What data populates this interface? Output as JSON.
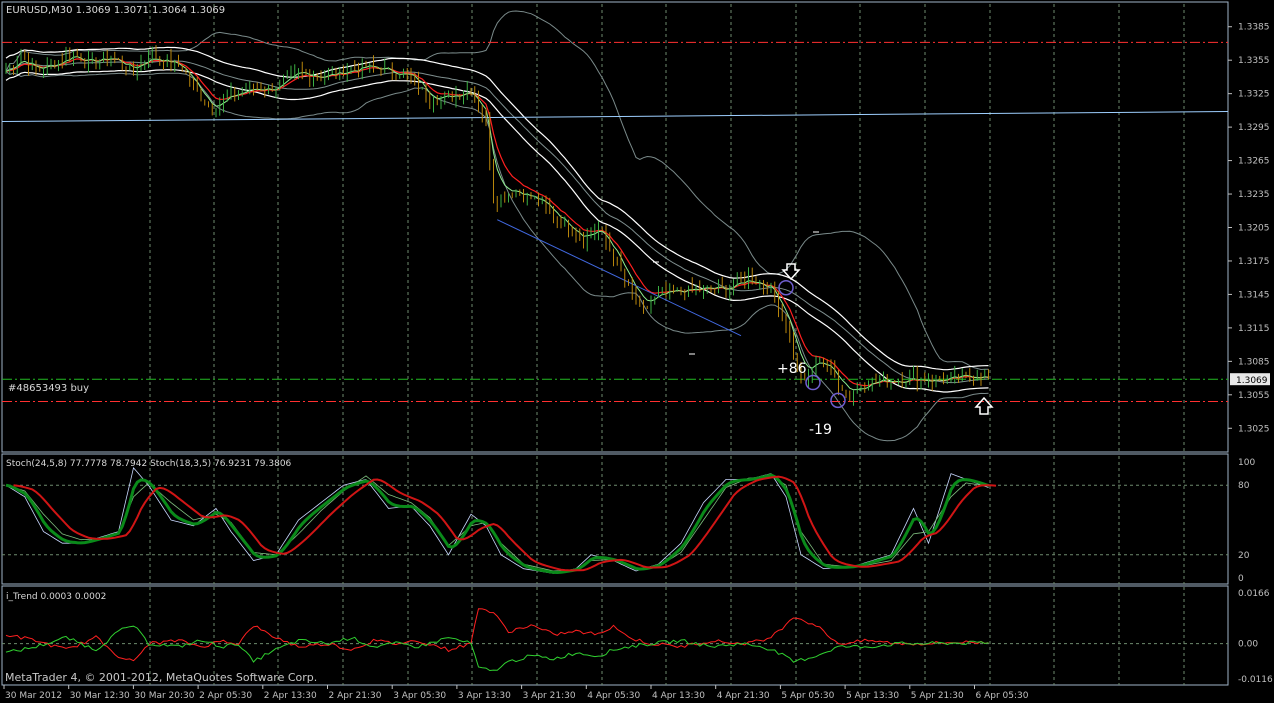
{
  "window": {
    "title": "EURUSD,M30 1.3069 1.3071 1.3064 1.3069",
    "copyright": "MetaTrader 4, © 2001-2012, MetaQuotes Software Corp."
  },
  "main_panel": {
    "order_label": "#48653493 buy",
    "current_price": "1.3069",
    "trade_annotations": [
      "+86",
      "-19"
    ],
    "price_axis": [
      "1.3385",
      "1.3355",
      "1.3325",
      "1.3295",
      "1.3265",
      "1.3235",
      "1.3205",
      "1.3175",
      "1.3145",
      "1.3115",
      "1.3085",
      "1.3055",
      "1.3025"
    ]
  },
  "stoch_panel": {
    "title": "Stoch(24,5,8) 77.7778 78.7942  Stoch(18,3,5) 76.9231 79.3806",
    "axis": [
      "100",
      "80",
      "20",
      "0"
    ]
  },
  "itrend_panel": {
    "title": "i_Trend 0.0003 0.0002",
    "axis": [
      "0.0166",
      "0.00",
      "-0.0116"
    ]
  },
  "time_axis": [
    "30 Mar 2012",
    "30 Mar 12:30",
    "30 Mar 20:30",
    "2 Apr 05:30",
    "2 Apr 13:30",
    "2 Apr 21:30",
    "3 Apr 05:30",
    "3 Apr 13:30",
    "3 Apr 21:30",
    "4 Apr 05:30",
    "4 Apr 13:30",
    "4 Apr 21:30",
    "5 Apr 05:30",
    "5 Apr 13:30",
    "5 Apr 21:30",
    "6 Apr 05:30"
  ],
  "colors": {
    "background": "#000000",
    "grid": "#6e8a6e",
    "panel_border": "#9fb3c8",
    "axis_text": "#c0c0c0",
    "bar": "#b8860b",
    "bar_bull": "#3cb043",
    "white_ma": "#ffffff",
    "red_ma": "#ff2020",
    "green_ma": "#90ee90",
    "bands": "#7a8a8a",
    "level_red": "#ff3030",
    "level_green": "#22bb22",
    "trendline": "#4169e1",
    "hline_blue": "#9ecfff",
    "stoch_green": "#0a8a1a",
    "stoch_red": "#d01515",
    "price_box": "#e8e8e8"
  },
  "chart_data": [
    {
      "type": "candlestick",
      "title": "EURUSD,M30 1.3069 1.3071 1.3064 1.3069",
      "ylim": [
        1.301,
        1.34
      ],
      "y_ticks": [
        1.3385,
        1.3355,
        1.3325,
        1.3295,
        1.3265,
        1.3235,
        1.3205,
        1.3175,
        1.3145,
        1.3115,
        1.3085,
        1.3055,
        1.3025
      ],
      "x_ticks": [
        "30 Mar 2012",
        "30 Mar 12:30",
        "30 Mar 20:30",
        "2 Apr 05:30",
        "2 Apr 13:30",
        "2 Apr 21:30",
        "3 Apr 05:30",
        "3 Apr 13:30",
        "3 Apr 21:30",
        "4 Apr 05:30",
        "4 Apr 13:30",
        "4 Apr 21:30",
        "5 Apr 05:30",
        "5 Apr 13:30",
        "5 Apr 21:30",
        "6 Apr 05:30"
      ],
      "price_key": [
        [
          0,
          1.3345
        ],
        [
          4,
          1.336
        ],
        [
          8,
          1.3345
        ],
        [
          13,
          1.3352
        ],
        [
          18,
          1.3362
        ],
        [
          22,
          1.3352
        ],
        [
          28,
          1.3358
        ],
        [
          34,
          1.3345
        ],
        [
          38,
          1.336
        ],
        [
          42,
          1.3355
        ],
        [
          47,
          1.3348
        ],
        [
          50,
          1.333
        ],
        [
          55,
          1.331
        ],
        [
          60,
          1.3325
        ],
        [
          66,
          1.333
        ],
        [
          72,
          1.333
        ],
        [
          78,
          1.3345
        ],
        [
          84,
          1.334
        ],
        [
          90,
          1.3345
        ],
        [
          96,
          1.335
        ],
        [
          102,
          1.3345
        ],
        [
          108,
          1.334
        ],
        [
          113,
          1.332
        ],
        [
          118,
          1.3322
        ],
        [
          124,
          1.333
        ],
        [
          128,
          1.33
        ],
        [
          130,
          1.323
        ],
        [
          136,
          1.3238
        ],
        [
          142,
          1.3228
        ],
        [
          148,
          1.321
        ],
        [
          154,
          1.3195
        ],
        [
          158,
          1.3205
        ],
        [
          162,
          1.318
        ],
        [
          166,
          1.315
        ],
        [
          170,
          1.313
        ],
        [
          174,
          1.3145
        ],
        [
          180,
          1.3148
        ],
        [
          186,
          1.315
        ],
        [
          192,
          1.315
        ],
        [
          198,
          1.316
        ],
        [
          204,
          1.315
        ],
        [
          208,
          1.312
        ],
        [
          211,
          1.308
        ],
        [
          213,
          1.3065
        ],
        [
          217,
          1.309
        ],
        [
          221,
          1.307
        ],
        [
          225,
          1.3055
        ],
        [
          230,
          1.3068
        ],
        [
          236,
          1.3068
        ],
        [
          242,
          1.307
        ],
        [
          248,
          1.3068
        ],
        [
          254,
          1.307
        ],
        [
          260,
          1.3073
        ],
        [
          262,
          1.3069
        ]
      ],
      "levels": {
        "red_upper": 1.3371,
        "red_lower": 1.3049,
        "green_entry": 1.3069,
        "blue_line": [
          1.33,
          1.3309
        ]
      },
      "annotations": [
        {
          "text": "+86",
          "x": 209,
          "y": 1.3089
        },
        {
          "text": "-19",
          "x": 219,
          "y": 1.3039
        }
      ],
      "order": "#48653493 buy",
      "series": []
    },
    {
      "type": "line",
      "title": "Stoch(24,5,8) 77.7778 78.7942  Stoch(18,3,5) 76.9231 79.3806",
      "ylim": [
        0,
        100
      ],
      "y_ticks": [
        100,
        80,
        20,
        0
      ],
      "series": [
        {
          "name": "",
          "key": [
            [
              0,
              80
            ],
            [
              5,
              70
            ],
            [
              10,
              40
            ],
            [
              15,
              30
            ],
            [
              20,
              30
            ],
            [
              25,
              35
            ],
            [
              30,
              40
            ],
            [
              34,
              95
            ],
            [
              38,
              80
            ],
            [
              44,
              50
            ],
            [
              50,
              45
            ],
            [
              56,
              60
            ],
            [
              60,
              40
            ],
            [
              66,
              15
            ],
            [
              72,
              20
            ],
            [
              78,
              50
            ],
            [
              84,
              65
            ],
            [
              90,
              80
            ],
            [
              96,
              85
            ],
            [
              102,
              60
            ],
            [
              108,
              62
            ],
            [
              113,
              45
            ],
            [
              118,
              20
            ],
            [
              124,
              55
            ],
            [
              128,
              45
            ],
            [
              132,
              20
            ],
            [
              138,
              8
            ],
            [
              146,
              4
            ],
            [
              152,
              8
            ],
            [
              156,
              20
            ],
            [
              162,
              15
            ],
            [
              168,
              6
            ],
            [
              174,
              12
            ],
            [
              180,
              30
            ],
            [
              186,
              65
            ],
            [
              192,
              85
            ],
            [
              198,
              85
            ],
            [
              204,
              90
            ],
            [
              208,
              70
            ],
            [
              212,
              20
            ],
            [
              218,
              8
            ],
            [
              226,
              10
            ],
            [
              236,
              20
            ],
            [
              242,
              60
            ],
            [
              246,
              30
            ],
            [
              252,
              90
            ],
            [
              256,
              85
            ],
            [
              262,
              78
            ]
          ]
        },
        {
          "name": "",
          "key": [
            [
              0,
              80
            ],
            [
              5,
              75
            ],
            [
              10,
              55
            ],
            [
              15,
              38
            ],
            [
              20,
              33
            ],
            [
              25,
              34
            ],
            [
              30,
              38
            ],
            [
              34,
              70
            ],
            [
              38,
              82
            ],
            [
              44,
              65
            ],
            [
              50,
              50
            ],
            [
              56,
              55
            ],
            [
              60,
              48
            ],
            [
              66,
              22
            ],
            [
              72,
              20
            ],
            [
              78,
              38
            ],
            [
              84,
              58
            ],
            [
              90,
              75
            ],
            [
              96,
              88
            ],
            [
              102,
              72
            ],
            [
              108,
              65
            ],
            [
              113,
              52
            ],
            [
              118,
              28
            ],
            [
              124,
              45
            ],
            [
              128,
              48
            ],
            [
              132,
              30
            ],
            [
              138,
              12
            ],
            [
              146,
              6
            ],
            [
              152,
              7
            ],
            [
              156,
              15
            ],
            [
              162,
              16
            ],
            [
              168,
              8
            ],
            [
              174,
              10
            ],
            [
              180,
              22
            ],
            [
              186,
              50
            ],
            [
              192,
              78
            ],
            [
              198,
              86
            ],
            [
              204,
              88
            ],
            [
              208,
              80
            ],
            [
              212,
              40
            ],
            [
              218,
              12
            ],
            [
              226,
              9
            ],
            [
              236,
              15
            ],
            [
              242,
              38
            ],
            [
              246,
              40
            ],
            [
              252,
              70
            ],
            [
              256,
              82
            ],
            [
              262,
              79
            ]
          ]
        }
      ]
    },
    {
      "type": "line",
      "title": "i_Trend 0.0003 0.0002",
      "ylim": [
        -0.0116,
        0.0166
      ],
      "y_ticks": [
        0.0166,
        0.0,
        -0.0116
      ],
      "series": [
        {
          "name": "",
          "key": [
            [
              0,
              0.003
            ],
            [
              8,
              0.001
            ],
            [
              16,
              -0.002
            ],
            [
              24,
              0.002
            ],
            [
              30,
              -0.004
            ],
            [
              34,
              -0.006
            ],
            [
              38,
              0.0
            ],
            [
              46,
              0.001
            ],
            [
              52,
              -0.001
            ],
            [
              58,
              0.001
            ],
            [
              62,
              0.0
            ],
            [
              66,
              0.006
            ],
            [
              70,
              0.003
            ],
            [
              78,
              -0.001
            ],
            [
              86,
              0.0
            ],
            [
              92,
              -0.002
            ],
            [
              98,
              0.001
            ],
            [
              104,
              0.0
            ],
            [
              110,
              0.001
            ],
            [
              118,
              -0.002
            ],
            [
              124,
              0.0
            ],
            [
              126,
              0.012
            ],
            [
              130,
              0.01
            ],
            [
              134,
              0.004
            ],
            [
              140,
              0.006
            ],
            [
              146,
              0.003
            ],
            [
              152,
              0.004
            ],
            [
              158,
              0.003
            ],
            [
              162,
              0.006
            ],
            [
              166,
              0.002
            ],
            [
              172,
              0.0
            ],
            [
              180,
              -0.001
            ],
            [
              188,
              0.001
            ],
            [
              196,
              0.0
            ],
            [
              202,
              0.001
            ],
            [
              206,
              0.004
            ],
            [
              210,
              0.009
            ],
            [
              216,
              0.006
            ],
            [
              222,
              0.0
            ],
            [
              230,
              0.001
            ],
            [
              238,
              0.0
            ],
            [
              246,
              0.0
            ],
            [
              254,
              0.0005
            ],
            [
              262,
              0.0003
            ]
          ]
        },
        {
          "name": "",
          "key": [
            [
              0,
              -0.003
            ],
            [
              8,
              -0.001
            ],
            [
              16,
              0.002
            ],
            [
              24,
              -0.002
            ],
            [
              30,
              0.004
            ],
            [
              34,
              0.006
            ],
            [
              38,
              0.0
            ],
            [
              46,
              -0.001
            ],
            [
              52,
              0.001
            ],
            [
              58,
              -0.001
            ],
            [
              62,
              0.0
            ],
            [
              66,
              -0.006
            ],
            [
              70,
              -0.003
            ],
            [
              78,
              0.001
            ],
            [
              86,
              0.0
            ],
            [
              92,
              0.002
            ],
            [
              98,
              -0.001
            ],
            [
              104,
              0.0
            ],
            [
              110,
              -0.001
            ],
            [
              118,
              0.002
            ],
            [
              124,
              0.0
            ],
            [
              126,
              -0.008
            ],
            [
              130,
              -0.009
            ],
            [
              134,
              -0.006
            ],
            [
              140,
              -0.004
            ],
            [
              146,
              -0.005
            ],
            [
              152,
              -0.003
            ],
            [
              158,
              -0.004
            ],
            [
              162,
              -0.002
            ],
            [
              166,
              -0.001
            ],
            [
              172,
              0.0
            ],
            [
              180,
              0.001
            ],
            [
              188,
              -0.001
            ],
            [
              196,
              0.0
            ],
            [
              202,
              -0.001
            ],
            [
              206,
              -0.003
            ],
            [
              210,
              -0.006
            ],
            [
              216,
              -0.004
            ],
            [
              222,
              -0.001
            ],
            [
              230,
              -0.001
            ],
            [
              238,
              0.0
            ],
            [
              246,
              0.0
            ],
            [
              254,
              0.0002
            ],
            [
              262,
              0.0002
            ]
          ]
        }
      ]
    }
  ]
}
